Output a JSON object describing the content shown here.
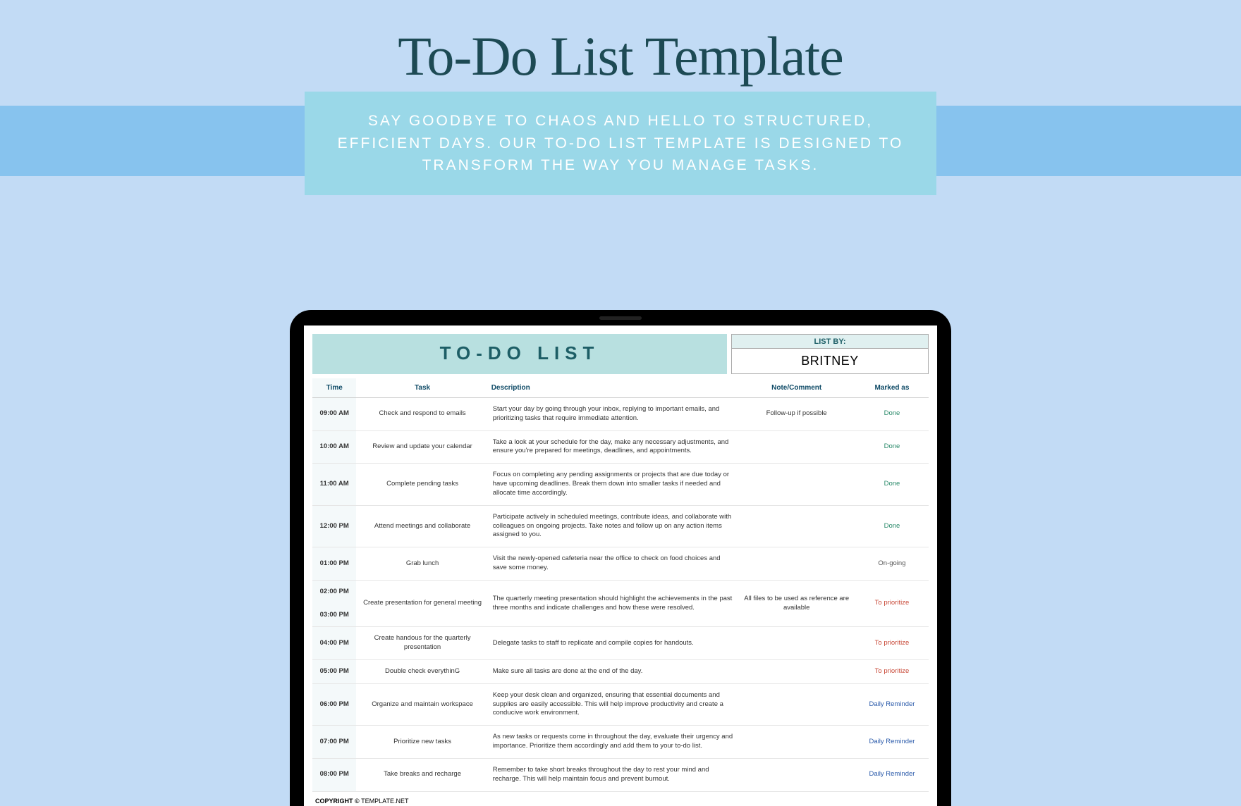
{
  "hero": {
    "title": "To-Do List Template",
    "subtitle": "SAY GOODBYE TO CHAOS AND HELLO TO STRUCTURED, EFFICIENT DAYS. OUR TO-DO LIST TEMPLATE IS DESIGNED TO TRANSFORM THE WAY YOU MANAGE TASKS."
  },
  "doc": {
    "title": "TO-DO LIST",
    "listby_label": "LIST BY:",
    "listby_value": "BRITNEY",
    "headers": {
      "time": "Time",
      "task": "Task",
      "desc": "Description",
      "note": "Note/Comment",
      "status": "Marked as"
    },
    "rows": [
      {
        "time": "09:00 AM",
        "task": "Check and respond to emails",
        "desc": "Start your day by going through your inbox, replying to important emails, and prioritizing tasks that require immediate attention.",
        "note": "Follow-up if possible",
        "status": "Done",
        "status_class": "status-done"
      },
      {
        "time": "10:00 AM",
        "task": "Review and update your calendar",
        "desc": "Take a look at your schedule for the day, make any necessary adjustments, and ensure you're prepared for meetings, deadlines, and appointments.",
        "note": "",
        "status": "Done",
        "status_class": "status-done"
      },
      {
        "time": "11:00 AM",
        "task": "Complete pending tasks",
        "desc": "Focus on completing any pending assignments or projects that are due today or have upcoming deadlines. Break them down into smaller tasks if needed and allocate time accordingly.",
        "note": "",
        "status": "Done",
        "status_class": "status-done"
      },
      {
        "time": "12:00 PM",
        "task": "Attend meetings and collaborate",
        "desc": "Participate actively in scheduled meetings, contribute ideas, and collaborate with colleagues on ongoing projects. Take notes and follow up on any action items assigned to you.",
        "note": "",
        "status": "Done",
        "status_class": "status-done"
      },
      {
        "time": "01:00 PM",
        "task": "Grab lunch",
        "desc": "Visit the newly-opened cafeteria near the office to check on food choices and save some money.",
        "note": "",
        "status": "On-going",
        "status_class": "status-ongoing"
      },
      {
        "time": "02:00 PM",
        "time2": "03:00 PM",
        "merged": true,
        "task": "Create presentation for general meeting",
        "desc": "The quarterly meeting presentation should highlight the achievements in the past three months and indicate challenges and how these were resolved.",
        "note": "All files to be used as reference are available",
        "status": "To prioritize",
        "status_class": "status-prio"
      },
      {
        "time": "04:00 PM",
        "task": "Create handous for the quarterly presentation",
        "desc": "Delegate tasks to staff to replicate and compile copies for handouts.",
        "note": "",
        "status": "To prioritize",
        "status_class": "status-prio"
      },
      {
        "time": "05:00 PM",
        "task": "Double check everythinG",
        "desc": "Make sure all tasks are done at the end of the day.",
        "note": "",
        "status": "To prioritize",
        "status_class": "status-prio"
      },
      {
        "time": "06:00 PM",
        "task": "Organize and maintain workspace",
        "desc": "Keep your desk clean and organized, ensuring that essential documents and supplies are easily accessible. This will help improve productivity and create a conducive work environment.",
        "note": "",
        "status": "Daily Reminder",
        "status_class": "status-reminder"
      },
      {
        "time": "07:00 PM",
        "task": "Prioritize new tasks",
        "desc": "As new tasks or requests come in throughout the day, evaluate their urgency and importance. Prioritize them accordingly and add them to your to-do list.",
        "note": "",
        "status": "Daily Reminder",
        "status_class": "status-reminder"
      },
      {
        "time": "08:00 PM",
        "task": "Take breaks and recharge",
        "desc": "Remember to take short breaks throughout the day to rest your mind and recharge. This will help maintain focus and prevent burnout.",
        "note": "",
        "status": "Daily Reminder",
        "status_class": "status-reminder"
      }
    ],
    "copyright_bold": "COPYRIGHT © ",
    "copyright_rest": "TEMPLATE.NET"
  }
}
